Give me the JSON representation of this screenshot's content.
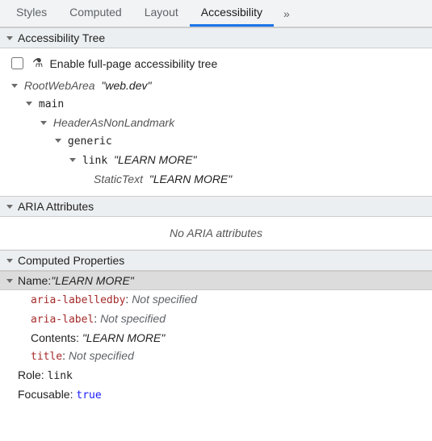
{
  "tabs": {
    "items": [
      "Styles",
      "Computed",
      "Layout",
      "Accessibility"
    ],
    "overflow_glyph": "»",
    "active_index": 3
  },
  "sections": {
    "tree_header": "Accessibility Tree",
    "aria_header": "ARIA Attributes",
    "computed_header": "Computed Properties"
  },
  "enable": {
    "label": "Enable full-page accessibility tree",
    "flask_glyph": "⚗"
  },
  "tree": {
    "n0_role": "RootWebArea",
    "n0_name": "\"web.dev\"",
    "n1_role": "main",
    "n2_role": "HeaderAsNonLandmark",
    "n3_role": "generic",
    "n4_role": "link",
    "n4_name": "\"LEARN MORE\"",
    "n5_role": "StaticText",
    "n5_name": "\"LEARN MORE\""
  },
  "aria": {
    "empty": "No ARIA attributes"
  },
  "computed": {
    "name_label": "Name: ",
    "name_value": "\"LEARN MORE\"",
    "labelledby_attr": "aria-labelledby",
    "labelledby_val": "Not specified",
    "arialabel_attr": "aria-label",
    "arialabel_val": "Not specified",
    "contents_label": "Contents: ",
    "contents_val": "\"LEARN MORE\"",
    "title_attr": "title",
    "title_val": "Not specified",
    "role_label": "Role: ",
    "role_val": "link",
    "focus_label": "Focusable: ",
    "focus_val": "true",
    "colon": ": "
  }
}
